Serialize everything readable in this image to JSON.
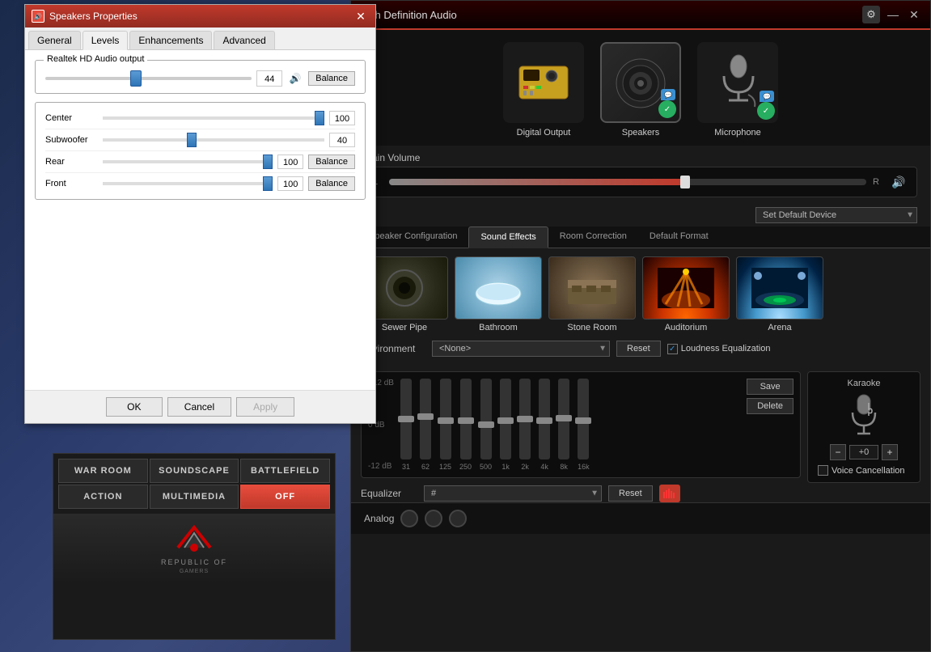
{
  "desktop": {
    "bg": "dark blue gradient"
  },
  "speakers_window": {
    "title": "Speakers Properties",
    "tabs": [
      "General",
      "Levels",
      "Enhancements",
      "Advanced"
    ],
    "active_tab": "Levels",
    "realtek_label": "Realtek HD Audio output",
    "realtek_value": "44",
    "balance_label": "Balance",
    "channels": [
      {
        "label": "Center",
        "value": "100",
        "pct": 100,
        "has_balance": false
      },
      {
        "label": "Subwoofer",
        "value": "40",
        "pct": 40,
        "has_balance": false
      },
      {
        "label": "Rear",
        "value": "100",
        "pct": 100,
        "has_balance": true
      },
      {
        "label": "Front",
        "value": "100",
        "pct": 100,
        "has_balance": true
      }
    ],
    "footer_buttons": [
      "OK",
      "Cancel",
      "Apply"
    ]
  },
  "rog_panel": {
    "buttons": [
      {
        "id": "war_room",
        "label": "WAR ROOM",
        "active": false
      },
      {
        "id": "soundscape",
        "label": "SOUNDSCAPE",
        "active": false
      },
      {
        "id": "battlefield",
        "label": "BATTLEFIELD",
        "active": false
      },
      {
        "id": "action",
        "label": "ACTION",
        "active": false
      },
      {
        "id": "multimedia",
        "label": "MULTIMEDIA",
        "active": false
      },
      {
        "id": "off",
        "label": "OFF",
        "active": true
      }
    ],
    "logo_text": "REPUBLIC OF",
    "logo_subtext": "GAMERS"
  },
  "hda_window": {
    "title": "High Definition Audio",
    "devices": [
      {
        "id": "digital_output",
        "label": "Digital Output",
        "selected": false,
        "has_green": false,
        "has_chat": false
      },
      {
        "id": "speakers",
        "label": "Speakers",
        "selected": true,
        "has_green": true,
        "has_chat": true
      },
      {
        "id": "microphone",
        "label": "Microphone",
        "selected": false,
        "has_green": true,
        "has_chat": true
      }
    ],
    "main_volume_label": "Main Volume",
    "vol_fill_pct": 62,
    "vol_thumb_pct": 62,
    "default_device_label": "Set Default Device",
    "tabs": [
      "Speaker Configuration",
      "Sound Effects",
      "Room Correction",
      "Default Format"
    ],
    "active_tab": "Sound Effects",
    "environments": [
      {
        "id": "sewer_pipe",
        "label": "Sewer Pipe",
        "emoji": "🕳"
      },
      {
        "id": "bathroom",
        "label": "Bathroom",
        "emoji": "🛁"
      },
      {
        "id": "stone_room",
        "label": "Stone Room",
        "emoji": "🏰"
      },
      {
        "id": "auditorium",
        "label": "Auditorium",
        "emoji": "🎭"
      },
      {
        "id": "arena",
        "label": "Arena",
        "emoji": "🏟"
      }
    ],
    "environment_label": "Environment",
    "environment_value": "<None>",
    "reset_label": "Reset",
    "loudness_label": "Loudness Equalization",
    "loudness_checked": true,
    "eq_labels": [
      "+12 dB",
      "0 dB",
      "-12 dB"
    ],
    "eq_bands": [
      {
        "freq": "31",
        "pos": 48
      },
      {
        "freq": "62",
        "pos": 45
      },
      {
        "freq": "125",
        "pos": 50
      },
      {
        "freq": "250",
        "pos": 50
      },
      {
        "freq": "500",
        "pos": 55
      },
      {
        "freq": "1k",
        "pos": 50
      },
      {
        "freq": "2k",
        "pos": 48
      },
      {
        "freq": "4k",
        "pos": 50
      },
      {
        "freq": "8k",
        "pos": 47
      },
      {
        "freq": "16k",
        "pos": 50
      }
    ],
    "eq_save_label": "Save",
    "eq_delete_label": "Delete",
    "eq_preset_label": "Equalizer",
    "eq_preset_value": "#",
    "eq_reset_label": "Reset",
    "karaoke_label": "Karaoke",
    "karaoke_volume": "+0",
    "karaoke_minus": "−",
    "karaoke_plus": "+",
    "voice_cancel_label": "Voice Cancellation",
    "analog_label": "Analog"
  }
}
